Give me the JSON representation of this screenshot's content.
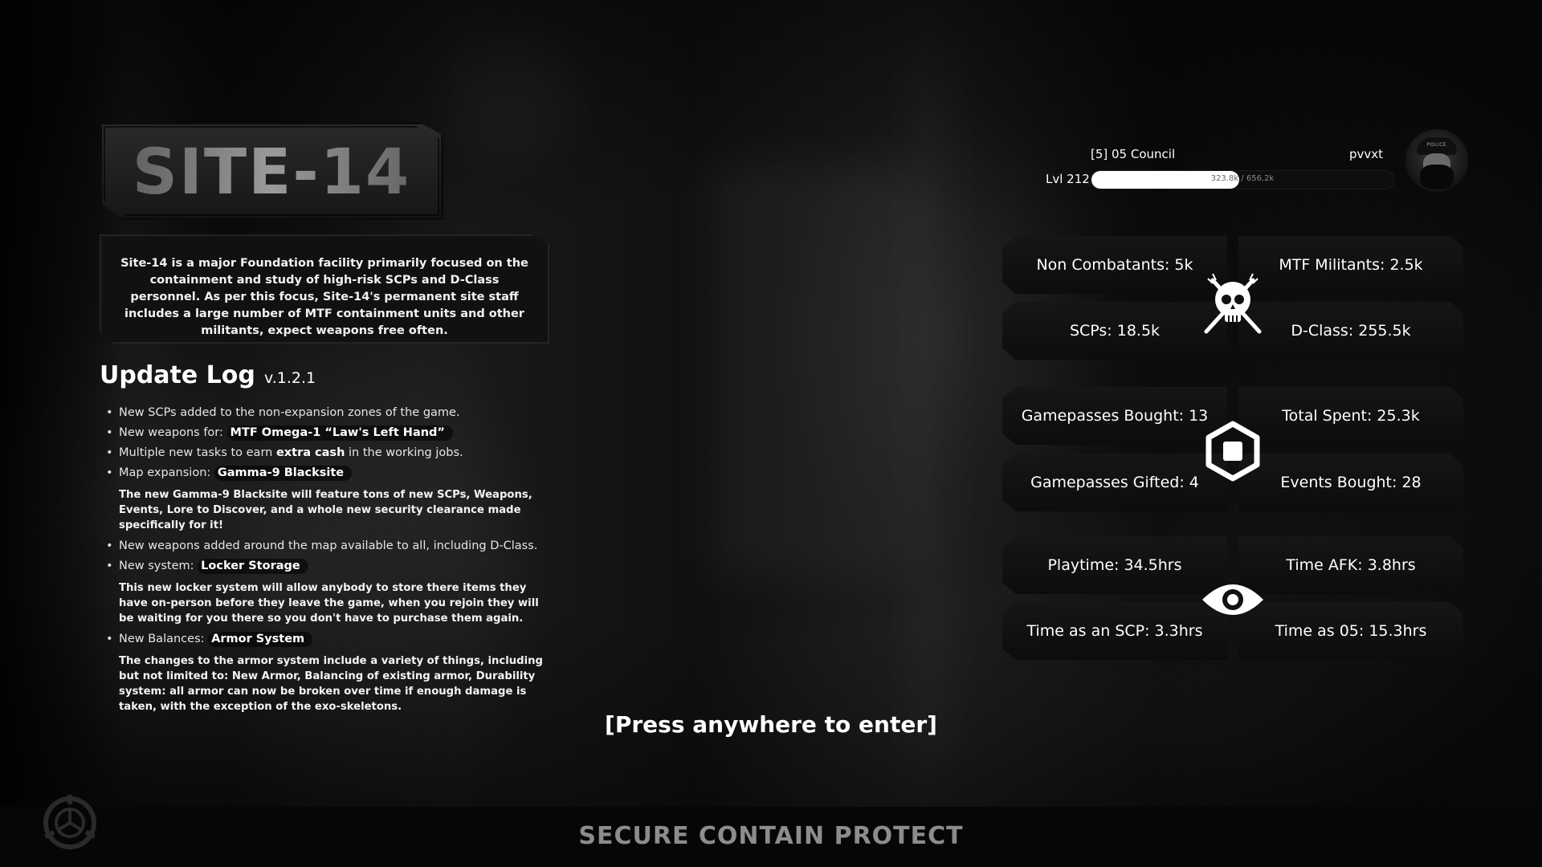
{
  "header": {
    "title": "SITE-14",
    "description": "Site-14 is a major Foundation facility primarily focused on the containment and study of high-risk SCPs and D-Class personnel. As per this focus, Site-14's permanent site staff includes a large number of MTF containment units and other militants, expect weapons free often."
  },
  "update_log": {
    "title": "Update Log",
    "version": "v.1.2.1",
    "items": [
      {
        "text": "New SCPs added to the non-expansion zones of the game."
      },
      {
        "prefix": "New weapons for:",
        "highlight": "MTF Omega-1 “Law's Left Hand”"
      },
      {
        "prefix": "Multiple new tasks to earn",
        "bold": "extra cash",
        "suffix": "in the working jobs."
      },
      {
        "prefix": "Map expansion:",
        "highlight": "Gamma-9 Blacksite",
        "detail": "The new Gamma-9 Blacksite will feature tons of new SCPs, Weapons, Events, Lore to Discover, and a whole new security clearance made specifically for it!"
      },
      {
        "text": "New weapons added around the map available to all, including D-Class."
      },
      {
        "prefix": "New system:",
        "highlight": "Locker Storage",
        "detail": "This new locker system will allow anybody to store there items they have on-person before they leave the game, when you rejoin they will be waiting for you there so you don't have to purchase them again."
      },
      {
        "prefix": "New Balances:",
        "highlight": "Armor System",
        "detail": "The changes to the armor system include a variety of things, including but not limited to: New Armor, Balancing of existing armor, Durability system: all armor can now be broken over time if enough damage is taken, with the exception of the exo-skeletons."
      }
    ]
  },
  "profile": {
    "rank": "[5] 05 Council",
    "username": "pvvxt",
    "level": "Lvl 212",
    "xp_current": "323.8k",
    "xp_separator": " / ",
    "xp_max": "656.2k",
    "xp_fraction": 0.49
  },
  "stats": {
    "population": {
      "icon": "skull-crossed-guns-icon",
      "non_combatants": "Non Combatants: 5k",
      "mtf_militants": "MTF Militants: 2.5k",
      "scps": "SCPs: 18.5k",
      "d_class": "D-Class: 255.5k"
    },
    "purchases": {
      "icon": "robux-icon",
      "gamepasses_bought": "Gamepasses Bought: 13",
      "total_spent": "Total Spent: 25.3k",
      "gamepasses_gifted": "Gamepasses Gifted: 4",
      "events_bought": "Events Bought: 28"
    },
    "time": {
      "icon": "eye-icon",
      "playtime": "Playtime: 34.5hrs",
      "time_afk": "Time AFK: 3.8hrs",
      "time_as_scp": "Time as an SCP: 3.3hrs",
      "time_as_05": "Time as 05: 15.3hrs"
    }
  },
  "prompt": "[Press anywhere to enter]",
  "footer": {
    "motto": "SECURE CONTAIN PROTECT",
    "logo": "scp-foundation-logo"
  }
}
